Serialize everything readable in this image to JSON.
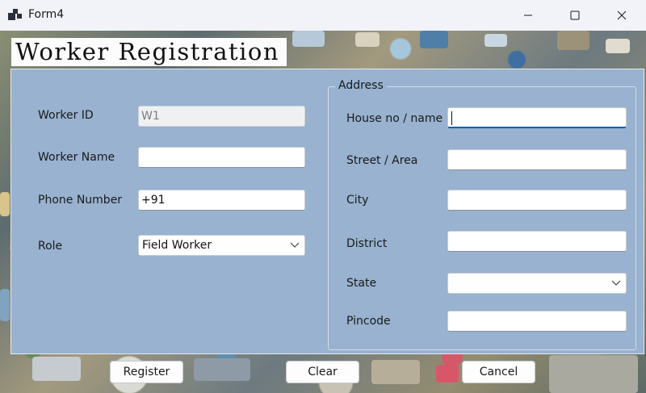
{
  "window": {
    "title": "Form4"
  },
  "banner": {
    "title": "Worker Registration"
  },
  "left": {
    "worker_id": {
      "label": "Worker ID",
      "value": "W1"
    },
    "worker_name": {
      "label": "Worker Name",
      "value": ""
    },
    "phone": {
      "label": "Phone Number",
      "value": "+91"
    },
    "role": {
      "label": "Role",
      "value": "Field Worker"
    }
  },
  "address": {
    "group_title": "Address",
    "house": {
      "label": "House no / name",
      "value": ""
    },
    "street": {
      "label": "Street / Area",
      "value": ""
    },
    "city": {
      "label": "City",
      "value": ""
    },
    "district": {
      "label": "District",
      "value": ""
    },
    "state": {
      "label": "State",
      "value": ""
    },
    "pincode": {
      "label": "Pincode",
      "value": ""
    }
  },
  "buttons": {
    "register": "Register",
    "clear": "Clear",
    "cancel": "Cancel"
  },
  "icons": {
    "app": "app-icon",
    "minimize": "minimize-icon",
    "maximize": "maximize-icon",
    "close": "close-icon",
    "dropdown": "chevron-down-icon"
  },
  "colors": {
    "panel": "#98b2cf",
    "titlebar": "#f1f3f9",
    "focus_accent": "#005fb8"
  }
}
